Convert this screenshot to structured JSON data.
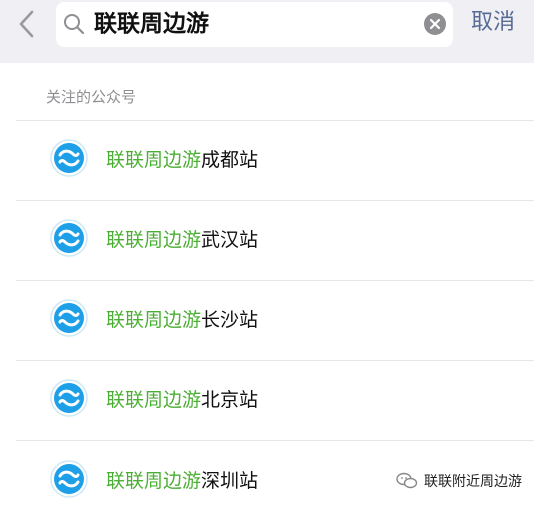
{
  "search": {
    "query": "联联周边游",
    "cancel_label": "取消"
  },
  "section": {
    "header": "关注的公众号"
  },
  "accounts": [
    {
      "highlight": "联联周边游",
      "suffix": "成都站",
      "icon": "lianlian-logo-icon"
    },
    {
      "highlight": "联联周边游",
      "suffix": "武汉站",
      "icon": "lianlian-logo-icon"
    },
    {
      "highlight": "联联周边游",
      "suffix": "长沙站",
      "icon": "lianlian-logo-icon"
    },
    {
      "highlight": "联联周边游",
      "suffix": "北京站",
      "icon": "lianlian-logo-icon"
    },
    {
      "highlight": "联联周边游",
      "suffix": "深圳站",
      "icon": "lianlian-logo-icon"
    }
  ],
  "watermark": {
    "text": "联联附近周边游",
    "icon": "wechat-icon"
  },
  "colors": {
    "highlight": "#4caf35",
    "cancel": "#576b95",
    "topbar_bg": "#efeff4",
    "logo_blue": "#1ea0e8"
  }
}
